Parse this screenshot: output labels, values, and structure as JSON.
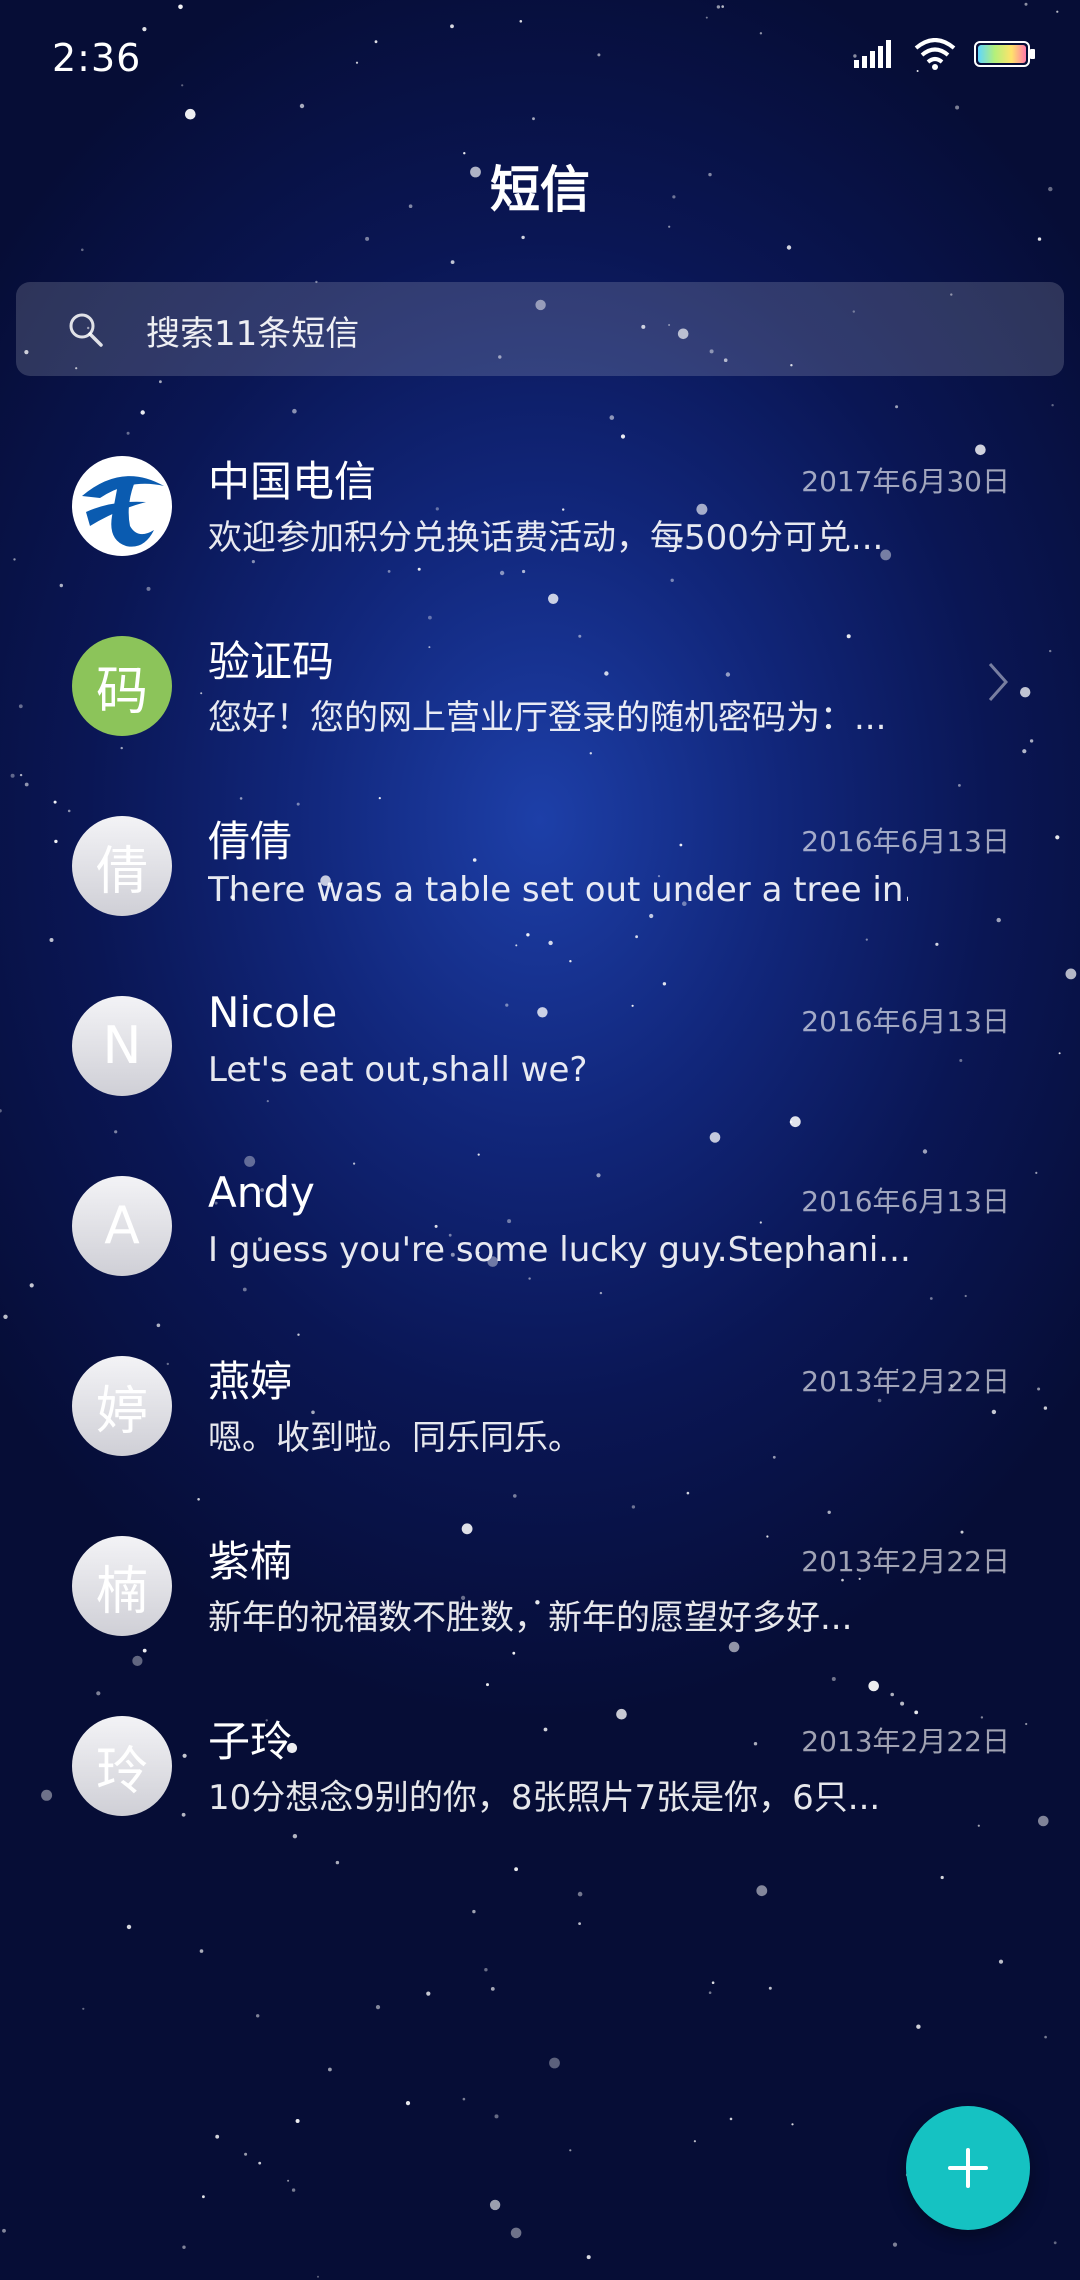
{
  "status_bar": {
    "time": "2:36",
    "icons": [
      "signal-icon",
      "wifi-icon",
      "battery-icon"
    ]
  },
  "header": {
    "title": "短信"
  },
  "search": {
    "placeholder": "搜索11条短信"
  },
  "conversations": [
    {
      "avatar": "",
      "avatar_type": "telecom-logo",
      "name": "中国电信",
      "date": "2017年6月30日",
      "preview": "欢迎参加积分兑换话费活动，每500分可兑..."
    },
    {
      "avatar": "码",
      "avatar_type": "green",
      "name": "验证码",
      "date": "",
      "preview": "您好！您的网上营业厅登录的随机密码为：..."
    },
    {
      "avatar": "倩",
      "avatar_type": "gray",
      "name": "倩倩",
      "date": "2016年6月13日",
      "preview": "There was a table set out under a tree in..."
    },
    {
      "avatar": "N",
      "avatar_type": "gray",
      "name": "Nicole",
      "date": "2016年6月13日",
      "preview": "Let's eat out,shall we?"
    },
    {
      "avatar": "A",
      "avatar_type": "gray",
      "name": "Andy",
      "date": "2016年6月13日",
      "preview": "I guess you're some lucky guy.Stephani..."
    },
    {
      "avatar": "婷",
      "avatar_type": "gray",
      "name": "燕婷",
      "date": "2013年2月22日",
      "preview": "嗯。收到啦。同乐同乐。"
    },
    {
      "avatar": "楠",
      "avatar_type": "gray",
      "name": "紫楠",
      "date": "2013年2月22日",
      "preview": "新年的祝福数不胜数，新年的愿望好多好..."
    },
    {
      "avatar": "玲",
      "avatar_type": "gray",
      "name": "子玲",
      "date": "2013年2月22日",
      "preview": "10分想念9别的你，8张照片7张是你，6只..."
    }
  ],
  "fab": {
    "icon": "plus-icon"
  },
  "colors": {
    "accent": "#15c2c2",
    "green_avatar": "#8cc45a",
    "background": "#0a1654"
  }
}
